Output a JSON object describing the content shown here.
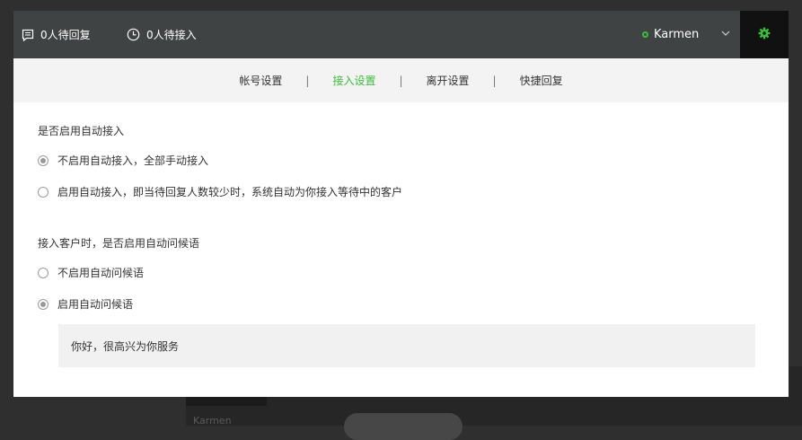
{
  "background": {
    "text": "Karmen"
  },
  "header": {
    "pending_reply": "0人待回复",
    "pending_access": "0人待接入",
    "username": "Karmen",
    "status_color": "#3dbb3d",
    "gear_color": "#3dbb3d"
  },
  "tabs": [
    {
      "label": "帐号设置",
      "active": false
    },
    {
      "label": "接入设置",
      "active": true
    },
    {
      "label": "离开设置",
      "active": false
    },
    {
      "label": "快捷回复",
      "active": false
    }
  ],
  "tab_separator": "|",
  "auto_access": {
    "title": "是否启用自动接入",
    "options": [
      {
        "label": "不启用自动接入，全部手动接入",
        "checked": true
      },
      {
        "label": "启用自动接入，即当待回复人数较少时，系统自动为你接入等待中的客户",
        "checked": false
      }
    ]
  },
  "auto_greeting": {
    "title": "接入客户时，是否启用自动问候语",
    "options": [
      {
        "label": "不启用自动问候语",
        "checked": false
      },
      {
        "label": "启用自动问候语",
        "checked": true
      }
    ],
    "message": "你好，很高兴为你服务"
  }
}
